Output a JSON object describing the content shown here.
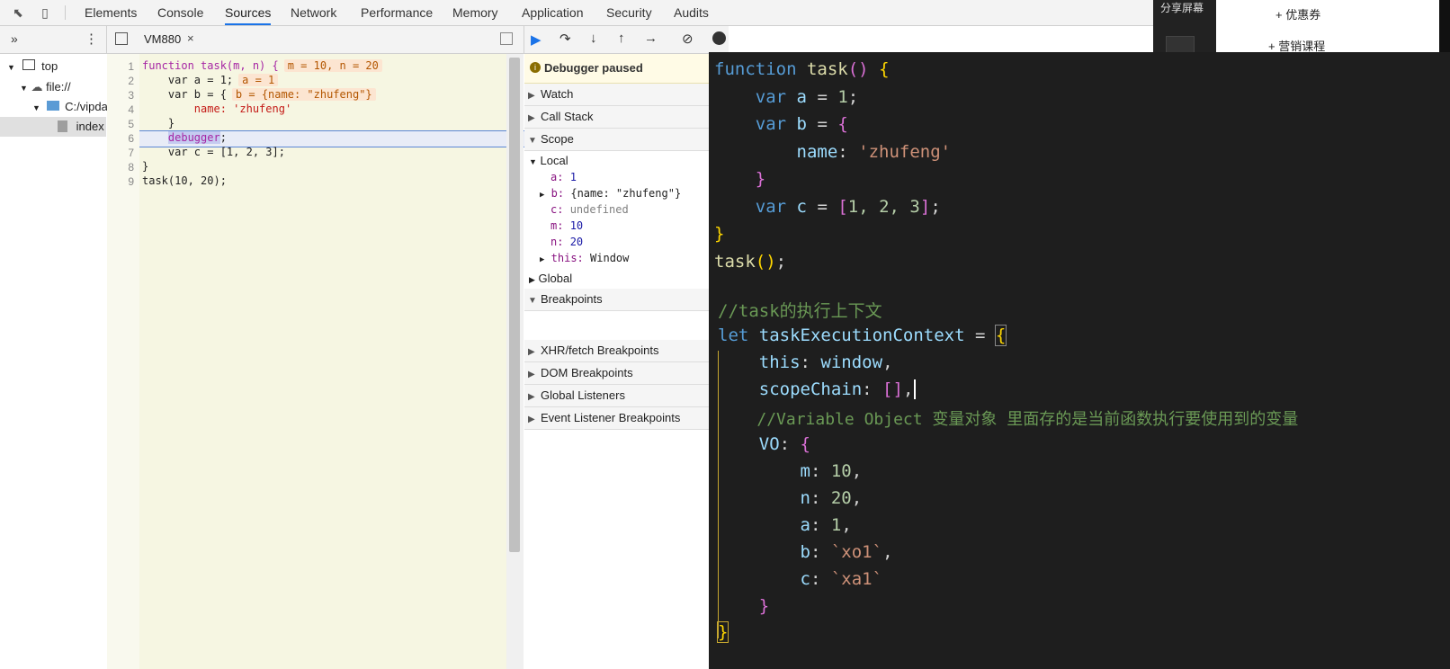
{
  "devtools": {
    "tabs": [
      "Elements",
      "Console",
      "Sources",
      "Network",
      "Performance",
      "Memory",
      "Application",
      "Security",
      "Audits"
    ],
    "active_tab": "Sources",
    "file_tab": "VM880",
    "file_tab_close": "×",
    "sidebar_more": "»",
    "sidebar_menu": "⋮",
    "tree": {
      "top": "top",
      "file": "file://",
      "folder": "C:/vipda",
      "index": "index"
    },
    "code_lines": [
      {
        "n": "1"
      },
      {
        "n": "2"
      },
      {
        "n": "3"
      },
      {
        "n": "4"
      },
      {
        "n": "5"
      },
      {
        "n": "6"
      },
      {
        "n": "7"
      },
      {
        "n": "8"
      },
      {
        "n": "9"
      }
    ],
    "code": {
      "l1_a": "function task(m, n) {",
      "l1_inline": "m = 10, n = 20",
      "l2_a": "    var a = 1;",
      "l2_inline": "a = 1",
      "l3_a": "    var b = {",
      "l3_inline": "b = {name: \"zhufeng\"}",
      "l4_a": "        name: 'zhufeng'",
      "l5_a": "    }",
      "l6_pre": "    ",
      "l6_hl": "debugger",
      "l6_post": ";",
      "l7_a": "    var c = [1, 2, 3];",
      "l8_a": "}",
      "l9_a": "task(10, 20);"
    },
    "paused": "Debugger paused",
    "sections": {
      "watch": "Watch",
      "call_stack": "Call Stack",
      "scope": "Scope",
      "local": "Local",
      "global": "Global",
      "breakpoints": "Breakpoints",
      "xhr": "XHR/fetch Breakpoints",
      "dom": "DOM Breakpoints",
      "global_listeners": "Global Listeners",
      "event_listener": "Event Listener Breakpoints"
    },
    "scope_vars": {
      "a_k": "a:",
      "a_v": "1",
      "b_k": "b:",
      "b_v": "{name: \"zhufeng\"}",
      "c_k": "c:",
      "c_v": "undefined",
      "m_k": "m:",
      "m_v": "10",
      "n_k": "n:",
      "n_v": "20",
      "this_k": "this:",
      "this_v": "Window"
    }
  },
  "right_panel": {
    "share": "分享屏幕",
    "coupon": "+ 优惠券",
    "course": "+ 营销课程"
  },
  "editor": {
    "l1_kw": "function",
    "l1_fn": "task",
    "l1_p": "()",
    "l1_b": "{",
    "l2_kw": "var",
    "l2_v": "a",
    "l2_op": " = ",
    "l2_n": "1",
    "l2_e": ";",
    "l3_kw": "var",
    "l3_v": "b",
    "l3_op": " = ",
    "l3_b": "{",
    "l4_v": "name",
    "l4_c": ": ",
    "l4_s": "'zhufeng'",
    "l5_b": "}",
    "l6_kw": "var",
    "l6_v": "c",
    "l6_op": " = ",
    "l6_b1": "[",
    "l6_n": "1, 2, 3",
    "l6_b2": "]",
    "l6_e": ";",
    "l7_b": "}",
    "l8_fn": "task",
    "l8_p": "()",
    "l8_e": ";",
    "c1": "//task的执行上下文",
    "let_kw": "let",
    "let_v": "taskExecutionContext",
    "let_op": " = ",
    "let_b": "{",
    "this_k": "this",
    "this_c": ": ",
    "this_v": "window",
    "this_e": ",",
    "sc_k": "scopeChain",
    "sc_c": ": ",
    "sc_v": "[]",
    "sc_e": ",",
    "c2": "//Variable Object 变量对象 里面存的是当前函数执行要使用到的变量",
    "vo_k": "VO",
    "vo_c": ": ",
    "vo_b": "{",
    "m_k": "m",
    "m_v": "10",
    "m_e": ",",
    "n_k": "n",
    "n_v": "20",
    "n_e": ",",
    "a_k": "a",
    "a_v": "1",
    "a_e": ",",
    "b_k": "b",
    "b_v": "`xo1`",
    "b_e": ",",
    "cc_k": "c",
    "cc_v": "`xa1`",
    "vo_close": "}",
    "ctx_close": "}"
  }
}
